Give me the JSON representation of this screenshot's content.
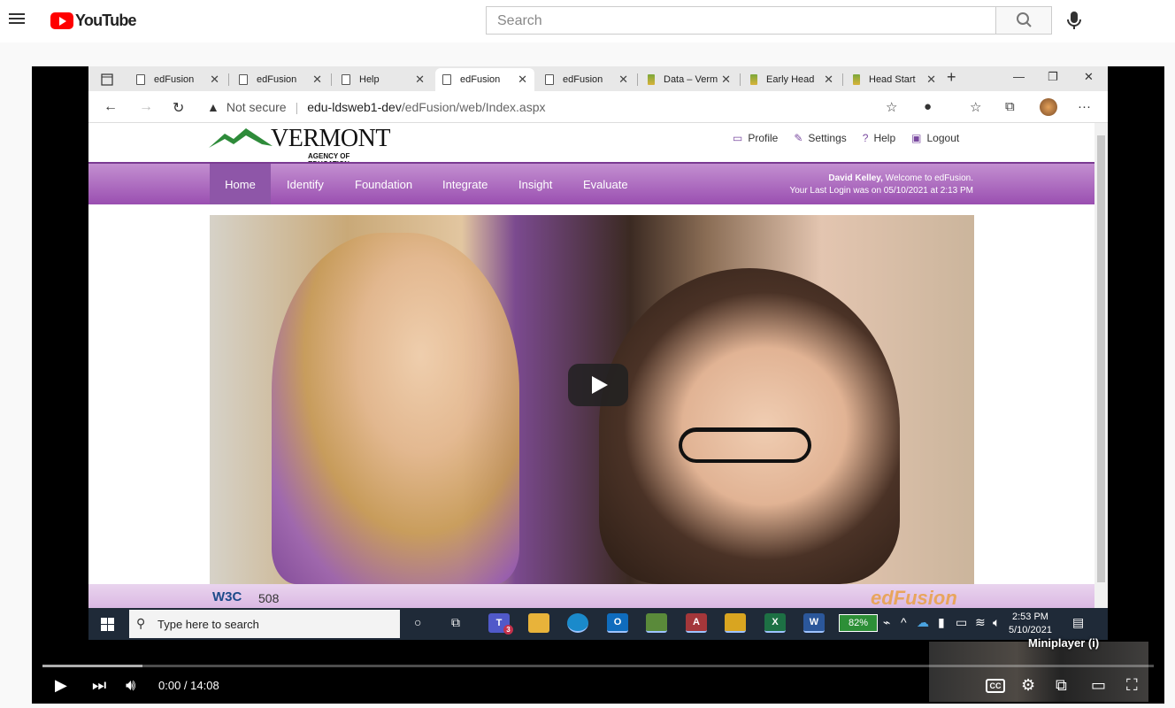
{
  "youtube": {
    "logo_text": "YouTube",
    "search_placeholder": "Search"
  },
  "browser": {
    "tabs": [
      {
        "label": "edFusion",
        "favicon": "page-icon"
      },
      {
        "label": "edFusion",
        "favicon": "page-icon"
      },
      {
        "label": "Help",
        "favicon": "page-icon"
      },
      {
        "label": "edFusion",
        "favicon": "page-icon",
        "active": true
      },
      {
        "label": "edFusion",
        "favicon": "page-icon"
      },
      {
        "label": "Data – Verm",
        "favicon": "vermont-icon"
      },
      {
        "label": "Early Head",
        "favicon": "vermont-icon"
      },
      {
        "label": "Head Start",
        "favicon": "vermont-icon"
      }
    ],
    "security_label": "Not secure",
    "url_host": "edu-ldsweb1-dev",
    "url_path": "/edFusion/web/Index.aspx"
  },
  "site": {
    "logo_title": "VERMONT",
    "logo_subtitle": "AGENCY OF EDUCATION",
    "top_links": [
      "Profile",
      "Settings",
      "Help",
      "Logout"
    ],
    "nav": [
      "Home",
      "Identify",
      "Foundation",
      "Integrate",
      "Insight",
      "Evaluate"
    ],
    "active_nav": "Home",
    "welcome_name": "David Kelley,",
    "welcome_text": " Welcome to edFusion.",
    "last_login": "Your Last Login was on 05/10/2021 at 2:13 PM",
    "footer_w3c": "W3C",
    "footer_508": "508",
    "footer_brand": "edFusion",
    "brand_color": "#9a4fb1"
  },
  "taskbar": {
    "search_placeholder": "Type here to search",
    "teams_badge": "3",
    "battery": "82%",
    "time": "2:53 PM",
    "date": "5/10/2021"
  },
  "player": {
    "time_current": "0:00",
    "time_separator": " / ",
    "time_total": "14:08",
    "miniplayer_tip": "Miniplayer (i)",
    "cc_label": "CC",
    "buffered_fraction": 0.09
  }
}
